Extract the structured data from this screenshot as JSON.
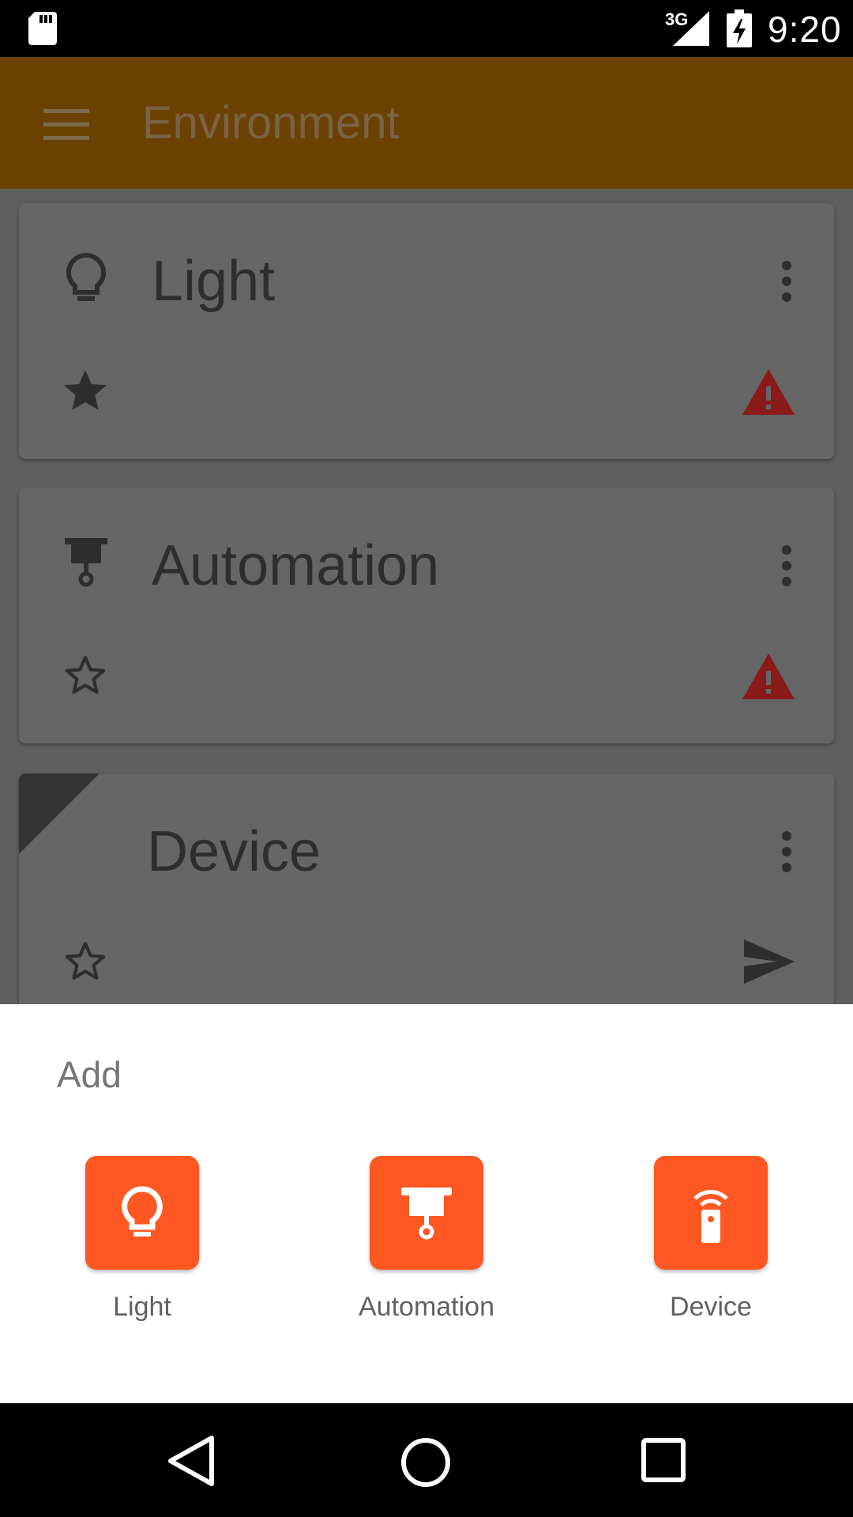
{
  "status_bar": {
    "network": "3G",
    "time": "9:20"
  },
  "app_bar": {
    "title": "Environment"
  },
  "cards": [
    {
      "title": "Light",
      "icon": "lightbulb-icon",
      "favorite": true,
      "status": "warning-icon"
    },
    {
      "title": "Automation",
      "icon": "projector-icon",
      "favorite": false,
      "status": "warning-icon"
    },
    {
      "title": "Device",
      "icon": "none",
      "favorite": false,
      "status": "send-icon"
    }
  ],
  "sheet": {
    "title": "Add",
    "options": [
      {
        "label": "Light",
        "icon": "lightbulb-icon"
      },
      {
        "label": "Automation",
        "icon": "projector-icon"
      },
      {
        "label": "Device",
        "icon": "remote-icon"
      }
    ]
  },
  "colors": {
    "accent": "#ff5722",
    "appbar_dimmed": "#6b4201",
    "warning": "#8b1a1a"
  }
}
